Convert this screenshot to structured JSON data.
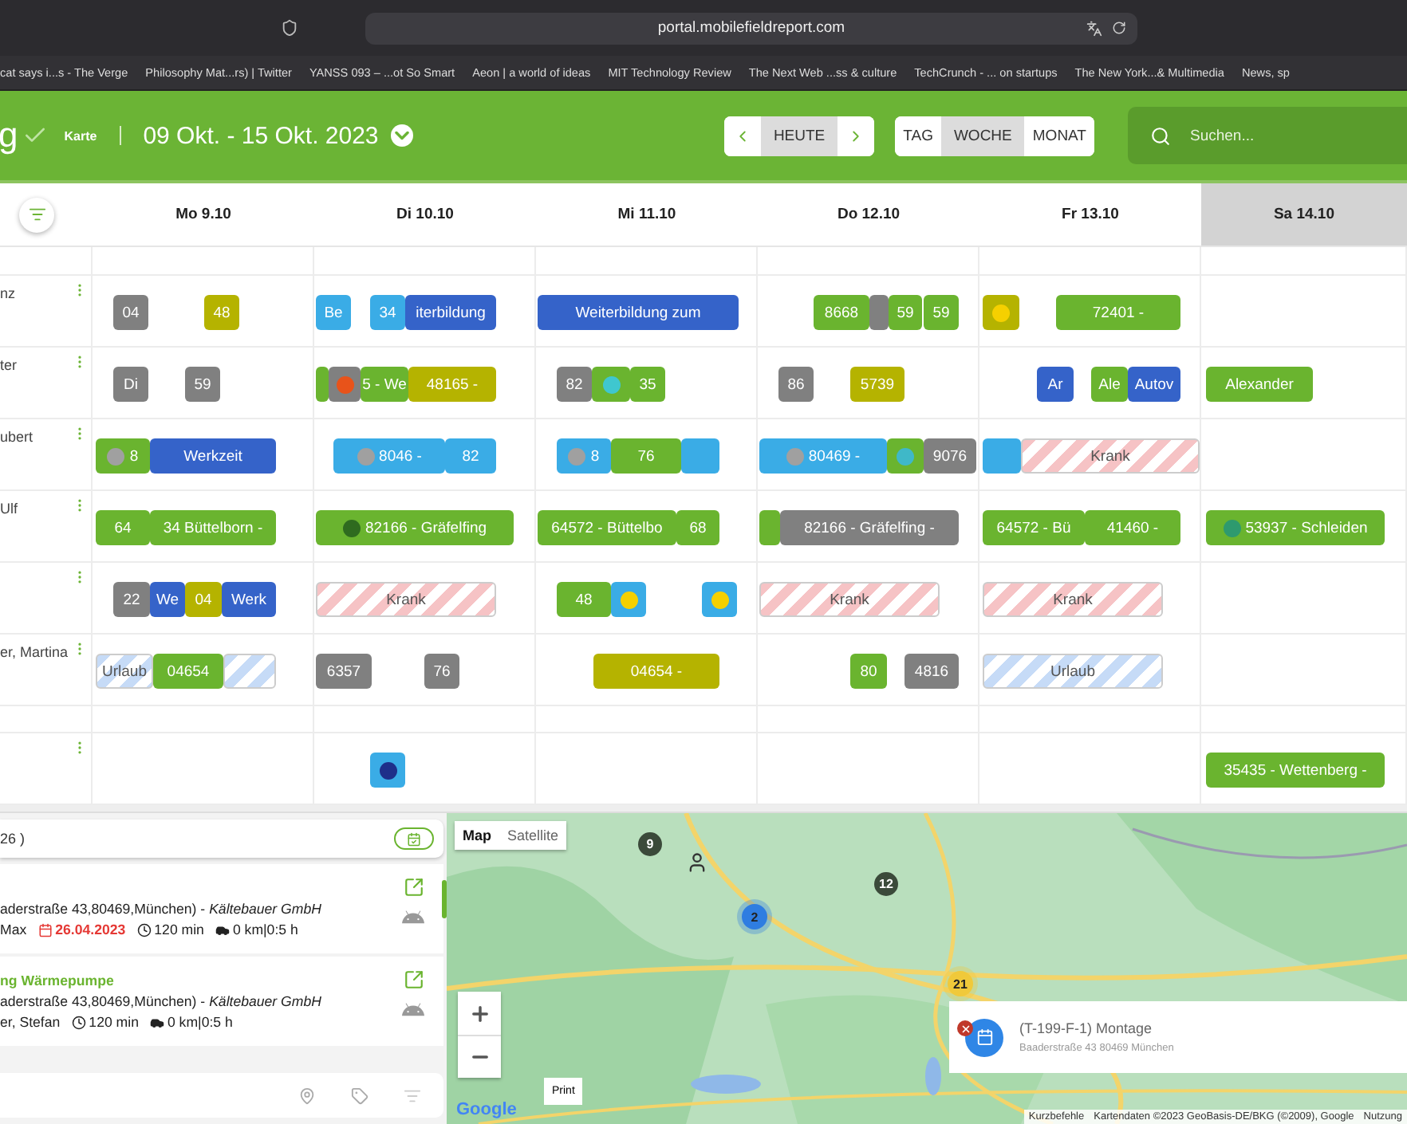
{
  "browser": {
    "url": "portal.mobilefieldreport.com",
    "bookmarks": [
      "cat says i...s - The Verge",
      "Philosophy Mat...rs) | Twitter",
      "YANSS 093 – ...ot So Smart",
      "Aeon | a world of ideas",
      "MIT Technology Review",
      "The Next Web ...ss & culture",
      "TechCrunch - ... on startups",
      "The New York...& Multimedia",
      "News, sp"
    ]
  },
  "header": {
    "title": "g",
    "view_link": "Karte",
    "date_range": "09 Okt. - 15 Okt. 2023",
    "today": {
      "label": "HEUTE",
      "selected": true
    },
    "views": [
      {
        "label": "TAG",
        "selected": false
      },
      {
        "label": "WOCHE",
        "selected": true
      },
      {
        "label": "MONAT",
        "selected": false
      }
    ],
    "search": {
      "placeholder": "Suchen..."
    }
  },
  "calendar": {
    "days": [
      {
        "label": "Mo 9.10",
        "selected": false
      },
      {
        "label": "Di 10.10",
        "selected": false
      },
      {
        "label": "Mi 11.10",
        "selected": false
      },
      {
        "label": "Do 12.10",
        "selected": false
      },
      {
        "label": "Fr 13.10",
        "selected": false
      },
      {
        "label": "Sa 14.10",
        "selected": true
      }
    ],
    "rows": [
      {
        "kind": "spacer"
      },
      {
        "kind": "employee",
        "name": "nz",
        "mo": [
          {
            "kind": "block",
            "color": "#808080",
            "text": "04"
          },
          {
            "kind": "block",
            "color": "#b5b300",
            "text": "48"
          }
        ],
        "di": [
          {
            "kind": "block",
            "color": "#3aace6",
            "text": "Be"
          },
          {
            "kind": "block",
            "color": "#3aace6",
            "text": "34"
          },
          {
            "kind": "block",
            "color": "#3563c9",
            "text": "iterbildung"
          }
        ],
        "mi": [
          {
            "kind": "block",
            "color": "#3563c9",
            "text": "Weiterbildung zum"
          }
        ],
        "do": [
          {
            "kind": "block",
            "color": "#6ab42f",
            "text": "8668"
          },
          {
            "kind": "block",
            "color": "#808080"
          },
          {
            "kind": "block",
            "color": "#6ab42f",
            "text": "59"
          },
          {
            "kind": "block",
            "color": "#6ab42f",
            "text": "59"
          }
        ],
        "fr": [
          {
            "kind": "block",
            "color": "#b5b300",
            "dot": {
              "color": "#f5d000"
            }
          },
          {
            "kind": "block",
            "color": "#6ab42f",
            "text": "72401 -"
          }
        ]
      },
      {
        "kind": "employee",
        "name": "ter",
        "mo": [
          {
            "kind": "block",
            "color": "#808080",
            "text": "Di"
          },
          {
            "kind": "block",
            "color": "#808080",
            "text": "59"
          }
        ],
        "di": [
          {
            "kind": "block",
            "color": "#6ab42f"
          },
          {
            "kind": "block",
            "color": "#808080",
            "dot": {
              "color": "#e8531a"
            }
          },
          {
            "kind": "block",
            "color": "#6ab42f",
            "text": "5 - We"
          },
          {
            "kind": "block",
            "color": "#b5b300",
            "text": "48165 -"
          }
        ],
        "mi": [
          {
            "kind": "block",
            "color": "#808080",
            "text": "82"
          },
          {
            "kind": "block",
            "color": "#6ab42f",
            "dot": {
              "color": "#3fc7cf"
            }
          },
          {
            "kind": "block",
            "color": "#6ab42f",
            "text": "35"
          }
        ],
        "do": [
          {
            "kind": "block",
            "color": "#808080",
            "text": "86"
          },
          {
            "kind": "block",
            "color": "#b5b300",
            "text": "5739"
          }
        ],
        "fr": [
          {
            "kind": "block",
            "color": "#3563c9",
            "text": "Ar"
          },
          {
            "kind": "block",
            "color": "#6ab42f",
            "text": "Ale"
          },
          {
            "kind": "block",
            "color": "#3563c9",
            "text": "Autov"
          }
        ],
        "sa": [
          {
            "kind": "block",
            "color": "#6ab42f",
            "text": "Alexander"
          }
        ]
      },
      {
        "kind": "employee",
        "name": "ubert",
        "mo": [
          {
            "kind": "block",
            "color": "#6ab42f",
            "text": "8",
            "dot": {
              "color": "#a0a0a0"
            }
          },
          {
            "kind": "block",
            "color": "#3563c9",
            "text": "Werkzeit"
          }
        ],
        "di": [
          {
            "kind": "block",
            "color": "#3aace6",
            "text": "8046 -",
            "dot": {
              "color": "#a0a0a0"
            }
          },
          {
            "kind": "block",
            "color": "#3aace6",
            "text": "82"
          }
        ],
        "mi": [
          {
            "kind": "block",
            "color": "#3aace6",
            "text": "8",
            "dot": {
              "color": "#a0a0a0"
            }
          },
          {
            "kind": "block",
            "color": "#6ab42f",
            "text": "76"
          },
          {
            "kind": "block",
            "color": "#3aace6"
          }
        ],
        "do": [
          {
            "kind": "block",
            "color": "#3aace6",
            "text": "80469 -",
            "dot": {
              "color": "#a0a0a0"
            }
          },
          {
            "kind": "block",
            "color": "#6ab42f",
            "dot": {
              "color": "#3fb8c8"
            }
          },
          {
            "kind": "block",
            "color": "#808080",
            "text": "9076"
          }
        ],
        "fr": [
          {
            "kind": "block",
            "color": "#3aace6"
          },
          {
            "kind": "striped",
            "color": "#f6c3c5",
            "text": "Krank"
          }
        ]
      },
      {
        "kind": "employee",
        "name": "Ulf",
        "mo": [
          {
            "kind": "block",
            "color": "#6ab42f",
            "text": "64"
          },
          {
            "kind": "block",
            "color": "#6ab42f",
            "text": "34 Büttelborn -"
          }
        ],
        "di": [
          {
            "kind": "block",
            "color": "#6ab42f",
            "text": "82166 - Gräfelfing",
            "dot": {
              "color": "#2f6b1f"
            }
          }
        ],
        "mi": [
          {
            "kind": "block",
            "color": "#6ab42f",
            "text": "64572 - Büttelbo"
          },
          {
            "kind": "block",
            "color": "#6ab42f",
            "text": "68"
          }
        ],
        "do": [
          {
            "kind": "block",
            "color": "#6ab42f"
          },
          {
            "kind": "block",
            "color": "#808080",
            "text": "82166 - Gräfelfing -"
          }
        ],
        "fr": [
          {
            "kind": "block",
            "color": "#6ab42f",
            "text": "64572 - Bü"
          },
          {
            "kind": "block",
            "color": "#6ab42f",
            "text": "41460 -"
          }
        ],
        "sa": [
          {
            "kind": "block",
            "color": "#6ab42f",
            "text": "53937 - Schleiden",
            "dot": {
              "color": "#2e9a6e"
            }
          }
        ]
      },
      {
        "kind": "employee",
        "mo": [
          {
            "kind": "block",
            "color": "#808080",
            "text": "22"
          },
          {
            "kind": "block",
            "color": "#3563c9",
            "text": "We"
          },
          {
            "kind": "block",
            "color": "#b5b300",
            "text": "04"
          },
          {
            "kind": "block",
            "color": "#3563c9",
            "text": "Werk"
          }
        ],
        "di": [
          {
            "kind": "striped",
            "color": "#f6c3c5",
            "text": "Krank"
          }
        ],
        "mi": [
          {
            "kind": "block",
            "color": "#6ab42f",
            "text": "48"
          },
          {
            "kind": "block",
            "color": "#3aace6",
            "dot": {
              "color": "#f5d000"
            }
          },
          {
            "kind": "block",
            "color": "#3aace6",
            "dot": {
              "color": "#f5d000"
            }
          }
        ],
        "do": [
          {
            "kind": "striped",
            "color": "#f6c3c5",
            "text": "Krank"
          }
        ],
        "fr": [
          {
            "kind": "striped",
            "color": "#f6c3c5",
            "text": "Krank"
          }
        ]
      },
      {
        "kind": "employee",
        "name": "er, Martina",
        "mo": [
          {
            "kind": "striped",
            "color": "#c6dbf7",
            "text": "Urlaub"
          },
          {
            "kind": "block",
            "color": "#6ab42f",
            "text": "04654"
          },
          {
            "kind": "striped",
            "color": "#c6dbf7"
          }
        ],
        "di": [
          {
            "kind": "block",
            "color": "#808080",
            "text": "6357"
          },
          {
            "kind": "block",
            "color": "#808080",
            "text": "76"
          }
        ],
        "mi": [
          {
            "kind": "block",
            "color": "#b5b300",
            "text": "04654 -"
          }
        ],
        "do": [
          {
            "kind": "block",
            "color": "#6ab42f",
            "text": "80"
          },
          {
            "kind": "block",
            "color": "#808080",
            "text": "4816"
          }
        ],
        "fr": [
          {
            "kind": "striped",
            "color": "#c6dbf7",
            "text": "Urlaub"
          }
        ]
      },
      {
        "kind": "spacer"
      },
      {
        "kind": "employee",
        "di": [
          {
            "kind": "block",
            "color": "#3aace6",
            "dot": {
              "color": "#1e2f8a"
            }
          }
        ],
        "sa": [
          {
            "kind": "block",
            "color": "#6ab42f",
            "text": "35435 - Wettenberg -"
          }
        ]
      }
    ]
  },
  "job_list": {
    "count": "26 )",
    "items": [
      {
        "address": "aderstraße 43,80469,München) - *Kältebauer GmbH*",
        "person": "Max",
        "date": "26.04.2023",
        "duration": "120 min",
        "distance": "0 km|0:5 h"
      },
      {
        "title": "ng Wärmepumpe",
        "address": "aderstraße 43,80469,München) - *Kältebauer GmbH*",
        "person": "er, Stefan",
        "duration": "120 min",
        "distance": "0 km|0:5 h"
      }
    ]
  },
  "map": {
    "map_types": [
      {
        "label": "Map",
        "selected": true
      },
      {
        "label": "Satellite",
        "selected": false
      }
    ],
    "markers": [
      {
        "kind": "pin",
        "label": "9"
      },
      {
        "kind": "person"
      },
      {
        "kind": "pin",
        "label": "12"
      },
      {
        "kind": "cluster",
        "label": "2",
        "color": "#2f7de1"
      },
      {
        "kind": "cluster",
        "label": "21",
        "color": "#f0c93a"
      }
    ],
    "print": "Print",
    "logo": "Google",
    "attribution": [
      "Kurzbefehle",
      "Kartendaten ©2023 GeoBasis-DE/BKG (©2009), Google",
      "Nutzung"
    ],
    "popup": {
      "title": "(T-199-F-1) Montage",
      "address": "Baaderstraße 43 80469 München"
    }
  }
}
